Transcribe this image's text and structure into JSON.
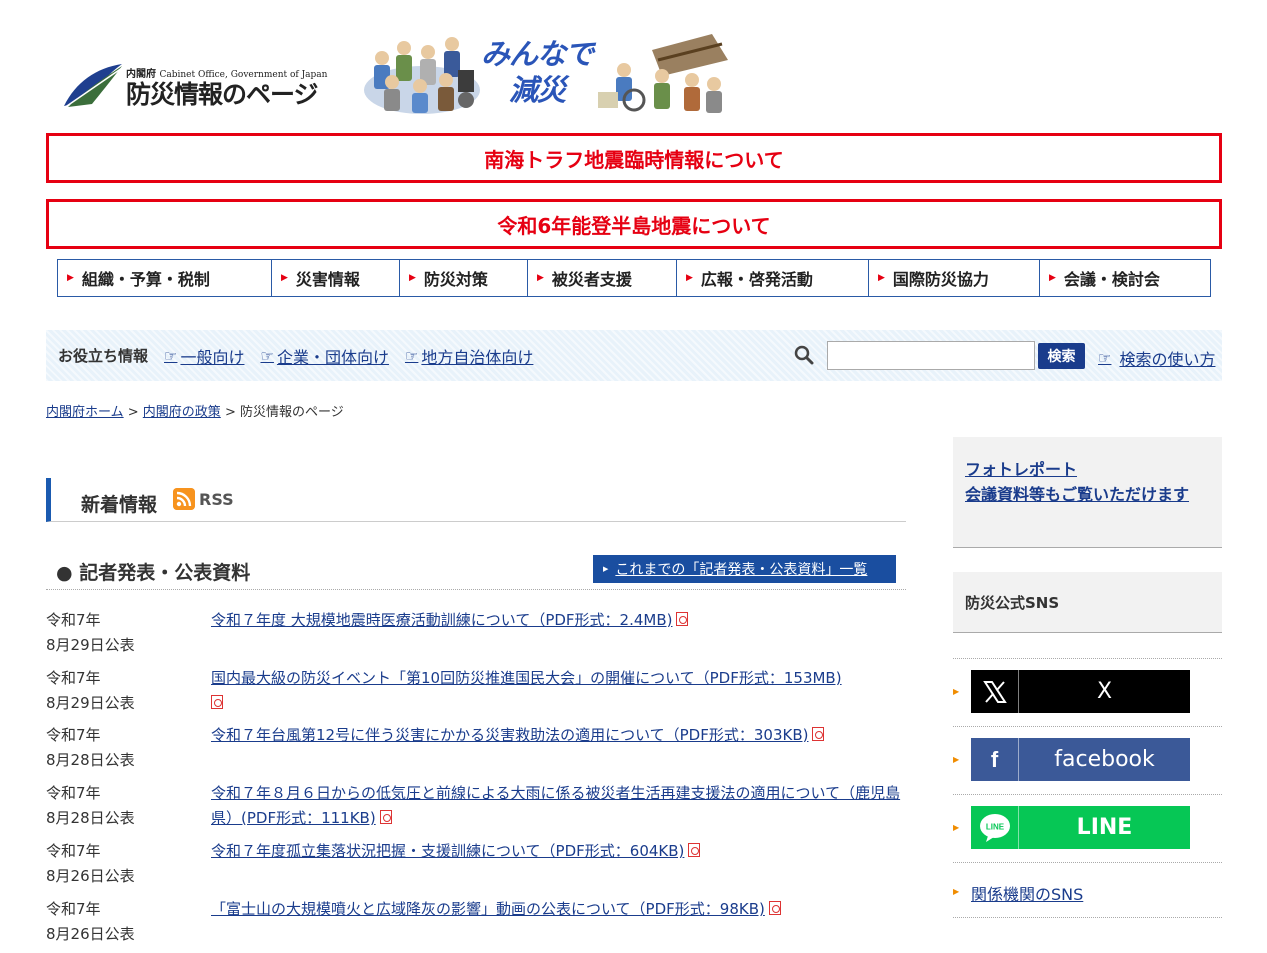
{
  "header": {
    "logo_small_ja": "内閣府",
    "logo_small_en": "Cabinet Office, Government of Japan",
    "logo_title": "防災情報のページ",
    "slogan_line1": "みんなで",
    "slogan_line2": "減災"
  },
  "alerts": [
    {
      "label": "南海トラフ地震臨時情報について"
    },
    {
      "label": "令和6年能登半島地震について"
    }
  ],
  "gnav": [
    {
      "label": "組織・予算・税制"
    },
    {
      "label": "災害情報"
    },
    {
      "label": "防災対策"
    },
    {
      "label": "被災者支援"
    },
    {
      "label": "広報・啓発活動"
    },
    {
      "label": "国際防災協力"
    },
    {
      "label": "会議・検討会"
    }
  ],
  "infobar": {
    "title": "お役立ち情報",
    "links": [
      {
        "label": "一般向け"
      },
      {
        "label": "企業・団体向け"
      },
      {
        "label": "地方自治体向け"
      }
    ],
    "search_button": "検索",
    "search_value": "",
    "search_help": "検索の使い方"
  },
  "breadcrumb": {
    "home": "内閣府ホーム",
    "sep1": " > ",
    "policy": "内閣府の政策",
    "sep2": " > ",
    "current": "防災情報のページ"
  },
  "news": {
    "title": "新着情報",
    "rss_label": "RSS",
    "press_title": "● 記者発表・公表資料",
    "archive_label": "これまでの「記者発表・公表資料」一覧",
    "items": [
      {
        "date1": "令和7年",
        "date2": "8月29日公表",
        "title": "令和７年度 大規模地震時医療活動訓練について（PDF形式：2.4MB)"
      },
      {
        "date1": "令和7年",
        "date2": "8月29日公表",
        "title": "国内最大級の防災イベント「第10回防災推進国民大会」の開催について（PDF形式：153MB)"
      },
      {
        "date1": "令和7年",
        "date2": "8月28日公表",
        "title": "令和７年台風第12号に伴う災害にかかる災害救助法の適用について（PDF形式：303KB)"
      },
      {
        "date1": "令和7年",
        "date2": "8月28日公表",
        "title": "令和７年８月６日からの低気圧と前線による大雨に係る被災者生活再建支援法の適用について（鹿児島県）(PDF形式：111KB)"
      },
      {
        "date1": "令和7年",
        "date2": "8月26日公表",
        "title": "令和７年度孤立集落状況把握・支援訓練について（PDF形式：604KB)"
      },
      {
        "date1": "令和7年",
        "date2": "8月26日公表",
        "title": "「富士山の大規模噴火と広域降灰の影響」動画の公表について（PDF形式：98KB)"
      }
    ]
  },
  "sidebar": {
    "photo_line1": "フォトレポート",
    "photo_line2": "会議資料等もご覧いただけます",
    "sns_title": "防災公式SNS",
    "sns": [
      {
        "name": "X",
        "color": "#000000"
      },
      {
        "name": "facebook",
        "color": "#3b5998"
      },
      {
        "name": "LINE",
        "color": "#06c755"
      }
    ],
    "line_icon_text": "LINE",
    "other_sns": "関係機関のSNS"
  }
}
